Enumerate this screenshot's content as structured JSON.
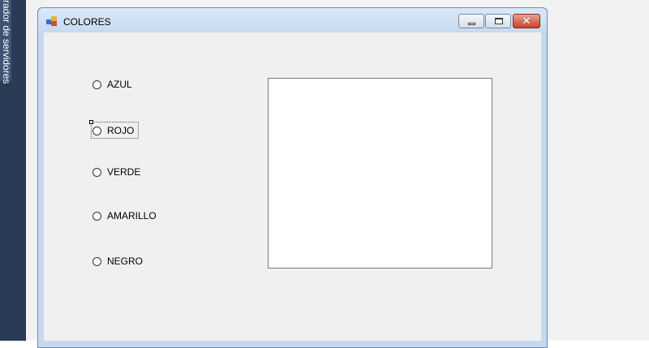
{
  "side_panel": {
    "tab_label": "rador de servidores"
  },
  "window": {
    "title": "COLORES",
    "close_glyph": "✕"
  },
  "radios": [
    {
      "label": "AZUL"
    },
    {
      "label": "ROJO"
    },
    {
      "label": "VERDE"
    },
    {
      "label": "AMARILLO"
    },
    {
      "label": "NEGRO"
    }
  ],
  "colors": {
    "title_bar": "#c6daf1",
    "close_button": "#c8412b",
    "form_background": "#f0f0f0",
    "panel": "#ffffff"
  },
  "icons": {
    "app": "form-icon",
    "minimize": "minimize-icon",
    "maximize": "maximize-icon",
    "close": "close-icon"
  }
}
